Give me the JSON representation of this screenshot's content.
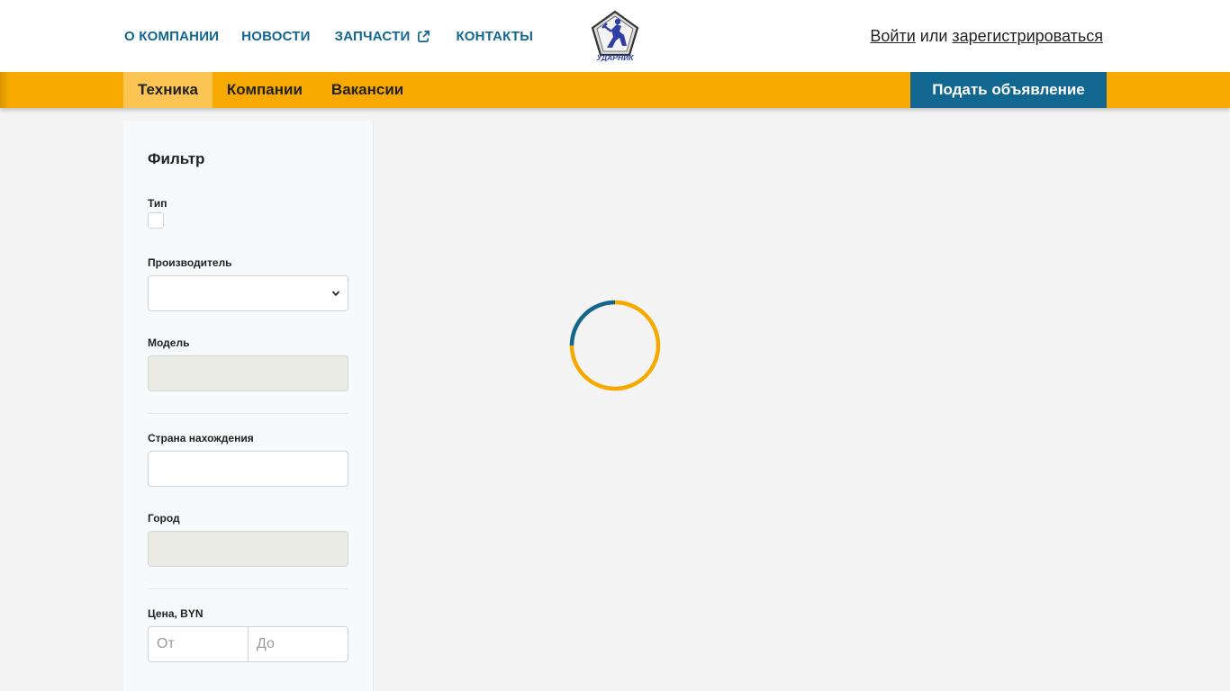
{
  "header": {
    "nav": [
      {
        "label": "О КОМПАНИИ"
      },
      {
        "label": "НОВОСТИ"
      },
      {
        "label": "ЗАПЧАСТИ"
      },
      {
        "label": "КОНТАКТЫ"
      }
    ],
    "logo_text": "УДАРНИК",
    "auth": {
      "login": "Войти",
      "or": "или",
      "register": "зарегистрироваться"
    }
  },
  "mainnav": {
    "tabs": [
      {
        "label": "Техника",
        "active": true
      },
      {
        "label": "Компании"
      },
      {
        "label": "Вакансии"
      }
    ],
    "post_button": "Подать объявление"
  },
  "filter": {
    "title": "Фильтр",
    "type_label": "Тип",
    "manufacturer_label": "Производитель",
    "model_label": "Модель",
    "country_label": "Страна нахождения",
    "city_label": "Город",
    "price_label": "Цена, BYN",
    "price_from_placeholder": "От",
    "price_to_placeholder": "До"
  },
  "colors": {
    "accent_yellow": "#f7a900",
    "accent_blue": "#11678f",
    "active_tab": "#fbc453"
  },
  "icons": [
    "external-link-icon",
    "logo-icon",
    "chevron-down-icon",
    "loading-spinner-icon"
  ]
}
